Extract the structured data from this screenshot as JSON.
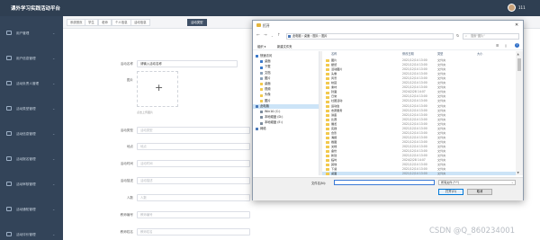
{
  "app": {
    "title": "课外学习实践活动平台",
    "user_name": "111"
  },
  "sidebar": {
    "items": [
      {
        "label": "用户管理"
      },
      {
        "label": "用户信息管理"
      },
      {
        "label": "活动负责人管理"
      },
      {
        "label": "活动类型管理"
      },
      {
        "label": "活动信息管理"
      },
      {
        "label": "活动报名管理"
      },
      {
        "label": "活动审核管理"
      },
      {
        "label": "活动通知管理"
      },
      {
        "label": "活动评价管理"
      }
    ]
  },
  "tabs": [
    {
      "label": "系统首页"
    },
    {
      "label": "学生"
    },
    {
      "label": "老师"
    },
    {
      "label": "个人信息"
    },
    {
      "label": "活动信息"
    },
    {
      "label": "活动类型"
    }
  ],
  "form": {
    "fields": [
      {
        "label": "活动名称",
        "value": "请输入活动名称",
        "placeholder": true
      },
      {
        "label": "图片",
        "value": "",
        "placeholder": false
      },
      {
        "label": "活动类型",
        "value": "活动类型",
        "placeholder": true
      },
      {
        "label": "地点",
        "value": "地点",
        "placeholder": true
      },
      {
        "label": "活动时间",
        "value": "活动时间",
        "placeholder": true
      },
      {
        "label": "活动描述",
        "value": "活动描述",
        "placeholder": true
      },
      {
        "label": "人数",
        "value": "人数",
        "placeholder": true
      },
      {
        "label": "负责人",
        "value": "负责人",
        "placeholder": true
      },
      {
        "label": "教师编号",
        "value": "教师编号",
        "placeholder": true
      },
      {
        "label": "教师姓名",
        "value": "教师姓名",
        "placeholder": true
      }
    ],
    "upload_tip": "点击上传图片"
  },
  "dialog": {
    "title": "打开",
    "address_path": "此电脑 › 桌面 › 图片 › 图片",
    "search_placeholder": "搜索\"图片\"",
    "organize_label": "组织 ▾",
    "new_folder_label": "新建文件夹",
    "nav_items": [
      {
        "label": "快速访问",
        "icon_color": "#3a78c9",
        "indent": 0
      },
      {
        "label": "桌面",
        "icon_color": "#3a78c9",
        "indent": 1
      },
      {
        "label": "下载",
        "icon_color": "#3a78c9",
        "indent": 1
      },
      {
        "label": "文档",
        "icon_color": "#8aa0b8",
        "indent": 1
      },
      {
        "label": "图片",
        "icon_color": "#8aa0b8",
        "indent": 1
      },
      {
        "label": "桌面",
        "icon_color": "#f2c94c",
        "indent": 1
      },
      {
        "label": "视频",
        "icon_color": "#f2c94c",
        "indent": 1
      },
      {
        "label": "头像",
        "icon_color": "#f2c94c",
        "indent": 1
      },
      {
        "label": "图片",
        "icon_color": "#f2c94c",
        "indent": 1
      },
      {
        "label": "此电脑",
        "icon_color": "#4a78b8",
        "indent": 0,
        "selected": true
      },
      {
        "label": "Win10 (C:)",
        "icon_color": "#7a8a9c",
        "indent": 1
      },
      {
        "label": "本地磁盘 (D:)",
        "icon_color": "#7a8a9c",
        "indent": 1
      },
      {
        "label": "本地磁盘 (E:)",
        "icon_color": "#7a8a9c",
        "indent": 1
      },
      {
        "label": "网络",
        "icon_color": "#4a78b8",
        "indent": 0
      }
    ],
    "columns": {
      "name": "名称",
      "date": "修改日期",
      "type": "类型",
      "size": "大小"
    },
    "files": [
      {
        "name": "图片",
        "date": "2021/12/14 13:00",
        "type": "文件夹"
      },
      {
        "name": "壁纸",
        "date": "2021/12/14 13:00",
        "type": "文件夹"
      },
      {
        "name": "活动图片",
        "date": "2021/12/14 13:00",
        "type": "文件夹"
      },
      {
        "name": "头像",
        "date": "2021/12/14 13:00",
        "type": "文件夹"
      },
      {
        "name": "风景",
        "date": "2021/12/14 13:00",
        "type": "文件夹"
      },
      {
        "name": "校园",
        "date": "2021/12/14 13:00",
        "type": "文件夹"
      },
      {
        "name": "素材",
        "date": "2021/12/14 13:00",
        "type": "文件夹"
      },
      {
        "name": "封面",
        "date": "2024/2/28 14:07",
        "type": "文件夹"
      },
      {
        "name": "日常",
        "date": "2021/12/14 13:00",
        "type": "文件夹"
      },
      {
        "name": "社团活动",
        "date": "2021/12/14 13:00",
        "type": "文件夹"
      },
      {
        "name": "运动会",
        "date": "2021/12/14 13:00",
        "type": "文件夹"
      },
      {
        "name": "志愿服务",
        "date": "2021/12/14 13:00",
        "type": "文件夹"
      },
      {
        "name": "讲座",
        "date": "2021/12/14 13:00",
        "type": "文件夹"
      },
      {
        "name": "比赛",
        "date": "2021/12/14 13:00",
        "type": "文件夹"
      },
      {
        "name": "展览",
        "date": "2021/12/14 13:00",
        "type": "文件夹"
      },
      {
        "name": "实践",
        "date": "2021/12/14 13:00",
        "type": "文件夹"
      },
      {
        "name": "合影",
        "date": "2021/12/14 13:00",
        "type": "文件夹"
      },
      {
        "name": "海报",
        "date": "2021/12/14 13:00",
        "type": "文件夹"
      },
      {
        "name": "截图",
        "date": "2021/12/14 13:00",
        "type": "文件夹"
      },
      {
        "name": "文档",
        "date": "2021/12/14 13:00",
        "type": "文件夹"
      },
      {
        "name": "备份",
        "date": "2021/12/14 13:00",
        "type": "文件夹"
      },
      {
        "name": "新建",
        "date": "2021/12/14 13:00",
        "type": "文件夹"
      },
      {
        "name": "临时",
        "date": "2024/2/28 14:07",
        "type": "文件夹"
      },
      {
        "name": "其他",
        "date": "2021/12/14 13:00",
        "type": "文件夹"
      },
      {
        "name": "下载",
        "date": "2021/12/14 13:00",
        "type": "文件夹"
      },
      {
        "name": "桌面",
        "date": "2021/12/14 13:00",
        "type": "文件夹",
        "selected": true
      }
    ],
    "filename_label": "文件名(N):",
    "filetype_value": "所有文件 (*.*)",
    "open_label": "打开(O)",
    "cancel_label": "取消"
  },
  "watermark": "CSDN @Q_860234001",
  "colors": {
    "topbar": "#2f3f52",
    "sidebar": "#334459",
    "tab_active": "#3f5066",
    "selection": "#cce4f7"
  }
}
